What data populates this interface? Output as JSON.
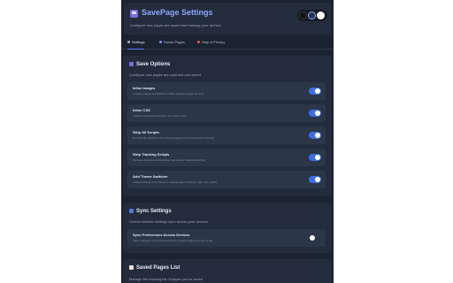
{
  "header": {
    "title": "SavePage Settings",
    "subtitle": "Configure how pages are saved and manage your archive",
    "logo_icon": "floppy-disk-icon"
  },
  "theme_switch": {
    "options": [
      "dark",
      "slate",
      "light"
    ],
    "selected": "slate",
    "colors": {
      "dark": "#141414",
      "slate": "#23334f",
      "light": "#ffffff"
    }
  },
  "tabs": [
    {
      "label": "Settings",
      "icon": "gear-icon",
      "active": true
    },
    {
      "label": "Saved Pages",
      "icon": "folder-icon",
      "active": false
    },
    {
      "label": "Help & Privacy",
      "icon": "pin-icon",
      "active": false
    }
  ],
  "save_options": {
    "title": "Save Options",
    "icon": "floppy-disk-icon",
    "description": "Configure how pages are captured and saved",
    "items": [
      {
        "label": "Inline Images",
        "description": "Convert images to base64 for offline viewing (larger file size)",
        "enabled": true
      },
      {
        "label": "Inline CSS",
        "description": "Include stylesheets directly in the saved page",
        "enabled": true
      },
      {
        "label": "Strip All Scripts",
        "description": "Remove all JavaScript from saved pages (recommended for security)",
        "enabled": true
      },
      {
        "label": "Strip Tracking Scripts",
        "description": "Remove analytics and tracking code (keeps functional scripts)",
        "enabled": true
      },
      {
        "label": "Add Theme Switcher",
        "description": "Include floating UI for theme to saved pages (Original, Light, Dim, Dark)",
        "enabled": true
      }
    ]
  },
  "sync_settings": {
    "title": "Sync Settings",
    "icon": "sync-icon",
    "description": "Control whether settings sync across your devices",
    "items": [
      {
        "label": "Sync Preferences Across Devices",
        "description": "Save settings to your Chrome account (saved pages list stays local)",
        "enabled": false
      }
    ]
  },
  "saved_pages_list": {
    "title": "Saved Pages List",
    "icon": "notepad-icon",
    "description": "Manage the tracking list of pages you've saved"
  },
  "colors": {
    "accent": "#3b6fe0",
    "title": "#8fa6ff",
    "background": "#1b2230",
    "card": "#232c3d",
    "option_row": "#2c3649"
  }
}
